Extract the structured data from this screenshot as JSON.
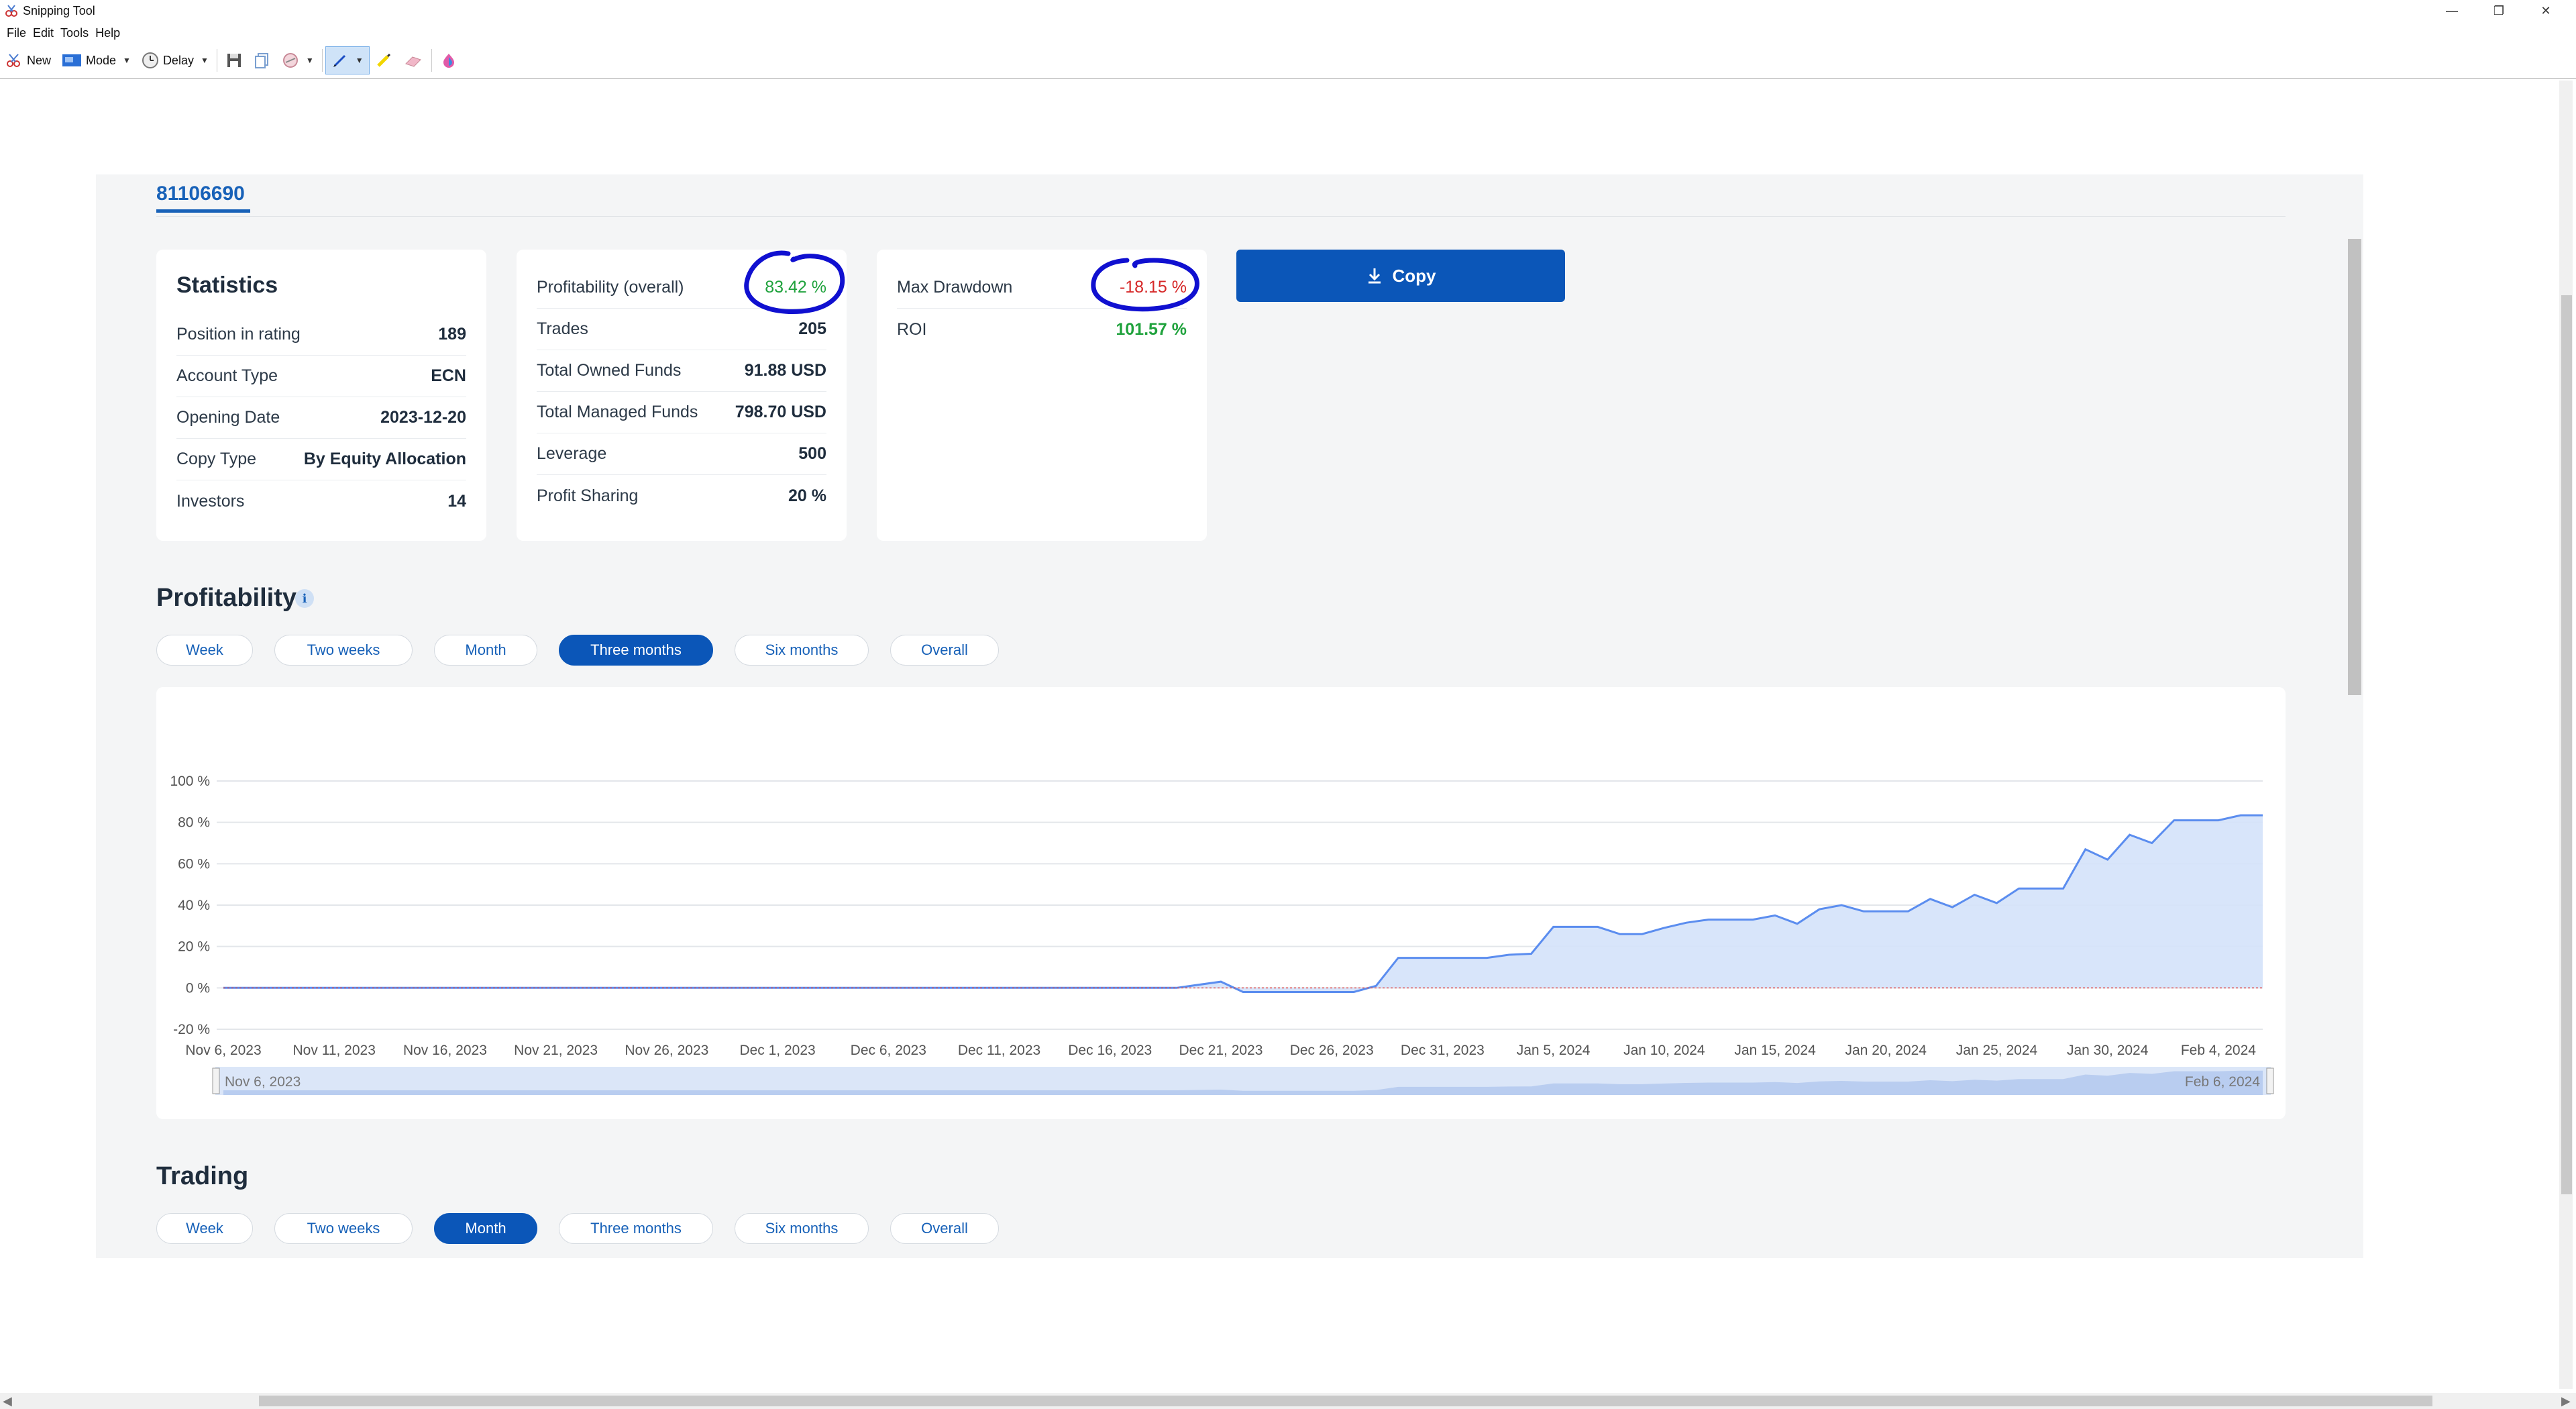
{
  "window": {
    "title": "Snipping Tool",
    "menu": [
      "File",
      "Edit",
      "Tools",
      "Help"
    ],
    "toolbar": {
      "new_label": "New",
      "mode_label": "Mode",
      "delay_label": "Delay"
    }
  },
  "account": {
    "number": "81106690"
  },
  "statistics": {
    "title": "Statistics",
    "rows": [
      {
        "label": "Position in rating",
        "value": "189"
      },
      {
        "label": "Account Type",
        "value": "ECN"
      },
      {
        "label": "Opening Date",
        "value": "2023-12-20"
      },
      {
        "label": "Copy Type",
        "value": "By Equity Allocation"
      },
      {
        "label": "Investors",
        "value": "14"
      }
    ]
  },
  "profitability_card": {
    "rows": [
      {
        "label": "Profitability (overall)",
        "value": "83.42 %"
      },
      {
        "label": "Trades",
        "value": "205"
      },
      {
        "label": "Total Owned Funds",
        "value": "91.88 USD"
      },
      {
        "label": "Total Managed Funds",
        "value": "798.70 USD"
      },
      {
        "label": "Leverage",
        "value": "500"
      },
      {
        "label": "Profit Sharing",
        "value": "20 %"
      }
    ]
  },
  "drawdown_card": {
    "rows": [
      {
        "label": "Max Drawdown",
        "value": "-18.15 %"
      },
      {
        "label": "ROI",
        "value": "101.57 %"
      }
    ]
  },
  "copy_button": {
    "label": "Copy"
  },
  "profitability_section": {
    "title": "Profitability",
    "periods": [
      "Week",
      "Two weeks",
      "Month",
      "Three months",
      "Six months",
      "Overall"
    ],
    "active_period": "Three months"
  },
  "trading_section": {
    "title": "Trading",
    "periods": [
      "Week",
      "Two weeks",
      "Month",
      "Three months",
      "Six months",
      "Overall"
    ],
    "active_period": "Month"
  },
  "chart_data": {
    "type": "area",
    "title": "",
    "xlabel": "",
    "ylabel": "",
    "y_unit": "%",
    "ylim": [
      -20,
      100
    ],
    "y_ticks": [
      "100 %",
      "80 %",
      "60 %",
      "40 %",
      "20 %",
      "0 %",
      "-20 %"
    ],
    "x_ticks": [
      "Nov 6, 2023",
      "Nov 11, 2023",
      "Nov 16, 2023",
      "Nov 21, 2023",
      "Nov 26, 2023",
      "Dec 1, 2023",
      "Dec 6, 2023",
      "Dec 11, 2023",
      "Dec 16, 2023",
      "Dec 21, 2023",
      "Dec 26, 2023",
      "Dec 31, 2023",
      "Jan 5, 2024",
      "Jan 10, 2024",
      "Jan 15, 2024",
      "Jan 20, 2024",
      "Jan 25, 2024",
      "Jan 30, 2024",
      "Feb 4, 2024"
    ],
    "grid": true,
    "zero_line": "dashed red",
    "colors": {
      "line": "#5b8def",
      "fill": "#d4e2fa",
      "navigator": "#dbe6f8"
    },
    "navigator_range": [
      "Nov 6, 2023",
      "Feb 6, 2024"
    ],
    "x": [
      "2023-11-06",
      "2023-12-19",
      "2023-12-21",
      "2023-12-22",
      "2023-12-27",
      "2023-12-28",
      "2023-12-29",
      "2024-01-02",
      "2024-01-03",
      "2024-01-04",
      "2024-01-05",
      "2024-01-07",
      "2024-01-08",
      "2024-01-09",
      "2024-01-10",
      "2024-01-11",
      "2024-01-12",
      "2024-01-13",
      "2024-01-14",
      "2024-01-15",
      "2024-01-16",
      "2024-01-17",
      "2024-01-18",
      "2024-01-19",
      "2024-01-20",
      "2024-01-21",
      "2024-01-22",
      "2024-01-23",
      "2024-01-24",
      "2024-01-25",
      "2024-01-26",
      "2024-01-27",
      "2024-01-28",
      "2024-01-29",
      "2024-01-30",
      "2024-01-31",
      "2024-02-01",
      "2024-02-02",
      "2024-02-03",
      "2024-02-04",
      "2024-02-05",
      "2024-02-06"
    ],
    "y": [
      0,
      0,
      3,
      -2,
      -2,
      1,
      14.5,
      14.5,
      16,
      16.5,
      29.5,
      29.5,
      26,
      26,
      29,
      31.5,
      33,
      33,
      33,
      35,
      31,
      38,
      40,
      37,
      37,
      37,
      43,
      39,
      45,
      41,
      48,
      48,
      48,
      67,
      62,
      74,
      70,
      81,
      81,
      81,
      83.42,
      83.42
    ]
  }
}
